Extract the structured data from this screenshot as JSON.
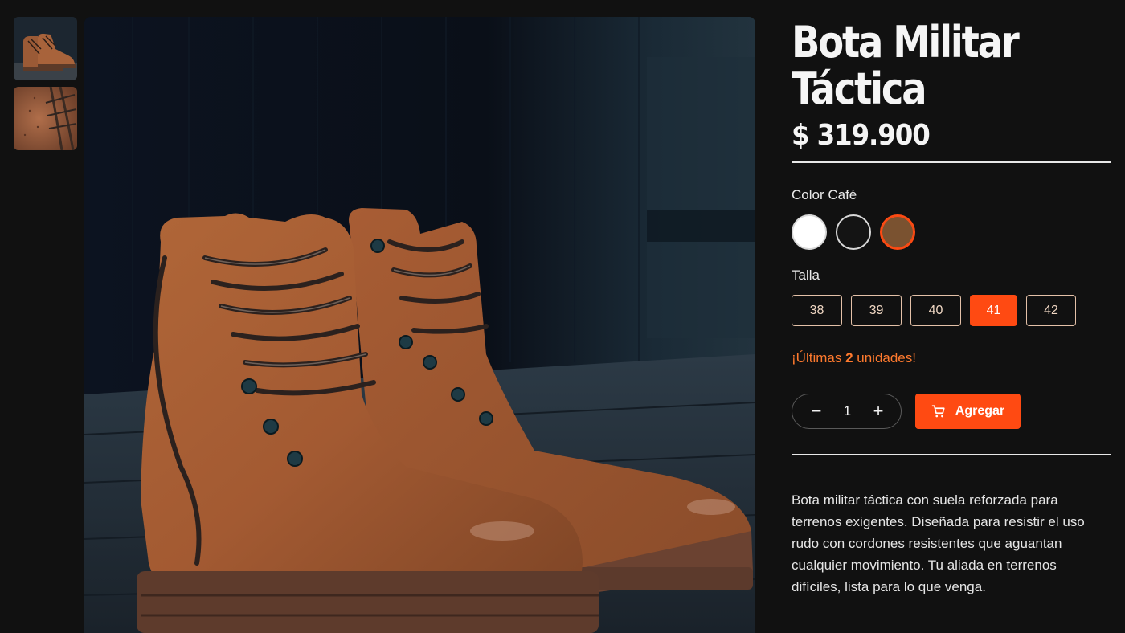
{
  "gallery": {
    "thumbnails": [
      {
        "alt": "boots-front-thumbnail",
        "icon": "boot-image"
      },
      {
        "alt": "leather-detail-thumbnail",
        "icon": "leather-texture-image"
      }
    ],
    "main_image": {
      "icon": "boots-photo"
    }
  },
  "product": {
    "title_line1": "Bota Militar",
    "title_line2": "Táctica",
    "price": "$ 319.900",
    "color_label": "Color Café",
    "colors": [
      {
        "name": "Blanco",
        "hex": "#ffffff",
        "selected": false
      },
      {
        "name": "Negro",
        "hex": "#141414",
        "selected": false
      },
      {
        "name": "Café",
        "hex": "#7a5230",
        "selected": true
      }
    ],
    "size_label": "Talla",
    "sizes": [
      {
        "value": "38",
        "selected": false
      },
      {
        "value": "39",
        "selected": false
      },
      {
        "value": "40",
        "selected": false
      },
      {
        "value": "41",
        "selected": true
      },
      {
        "value": "42",
        "selected": false
      }
    ],
    "stock_prefix": "¡Últimas ",
    "stock_count": "2",
    "stock_suffix": " unidades!",
    "quantity": {
      "minus": "−",
      "value": "1",
      "plus": "+"
    },
    "add_button": {
      "label": "Agregar",
      "icon": "cart-icon"
    },
    "description": "Bota militar táctica con suela reforzada para terrenos exigentes. Diseñada para resistir el uso rudo con cordones resistentes que aguantan cualquier movimiento. Tu aliada en terrenos difíciles, lista para lo que venga."
  },
  "colors": {
    "accent": "#ff4a12",
    "stock_text": "#ff7a2e",
    "background": "#111111"
  }
}
